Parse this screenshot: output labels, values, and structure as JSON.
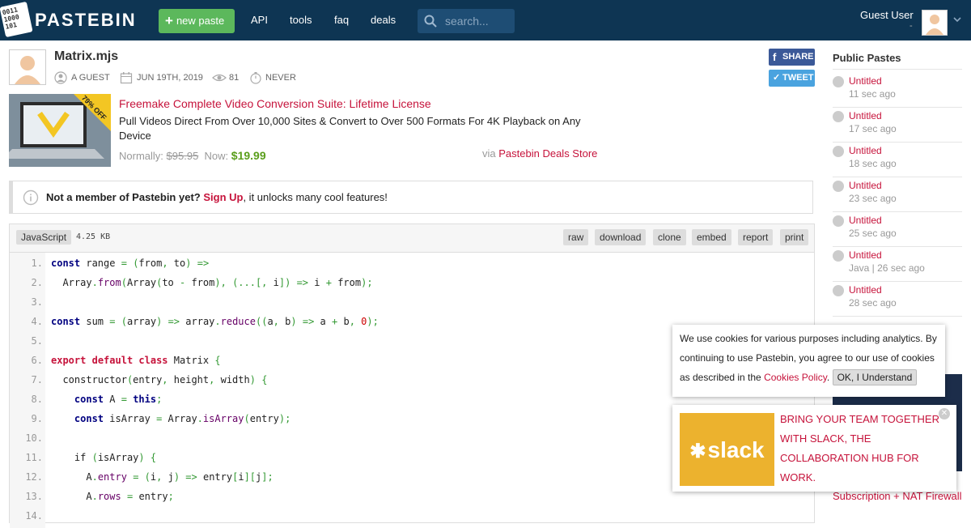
{
  "header": {
    "logo_text": "PASTEBIN",
    "logo_bits": "0011 1000 101",
    "new_paste": "new paste",
    "nav": [
      "API",
      "tools",
      "faq",
      "deals"
    ],
    "search_placeholder": "search...",
    "user_name": "Guest User",
    "user_sub": "-"
  },
  "paste": {
    "title": "Matrix.mjs",
    "author": "A GUEST",
    "date": "JUN 19TH, 2019",
    "views": "81",
    "expires": "NEVER",
    "share": "SHARE",
    "tweet": "TWEET"
  },
  "ad": {
    "badge": "79% OFF",
    "title": "Freemake Complete Video Conversion Suite: Lifetime License",
    "desc": "Pull Videos Direct From Over 10,000 Sites & Convert to Over 500 Formats For 4K Playback on Any Device",
    "normally_label": "Normally:",
    "normally_price": "$95.95",
    "now_label": "Now:",
    "now_price": "$19.99",
    "via_label": "via",
    "via_link": "Pastebin Deals Store"
  },
  "notice": {
    "bold": "Not a member of Pastebin yet?",
    "link": "Sign Up",
    "rest": ", it unlocks many cool features!"
  },
  "code": {
    "language": "JavaScript",
    "size": "4.25 KB",
    "buttons": [
      "raw",
      "download",
      "clone",
      "embed",
      "report",
      "print"
    ],
    "line_numbers": [
      "1.",
      "2.",
      "3.",
      "4.",
      "5.",
      "6.",
      "7.",
      "8.",
      "9.",
      "10.",
      "11.",
      "12.",
      "13.",
      "14."
    ],
    "lines": [
      "const range = (from, to) =>",
      "  Array.from(Array(to - from), (...[, i]) => i + from);",
      "",
      "const sum = (array) => array.reduce((a, b) => a + b, 0);",
      "",
      "export default class Matrix {",
      "  constructor(entry, height, width) {",
      "    const A = this;",
      "    const isArray = Array.isArray(entry);",
      "",
      "    if (isArray) {",
      "      A.entry = (i, j) => entry[i][j];",
      "      A.rows = entry;",
      ""
    ]
  },
  "sidebar": {
    "title": "Public Pastes",
    "items": [
      {
        "name": "Untitled",
        "time": "11 sec ago"
      },
      {
        "name": "Untitled",
        "time": "17 sec ago"
      },
      {
        "name": "Untitled",
        "time": "18 sec ago"
      },
      {
        "name": "Untitled",
        "time": "23 sec ago"
      },
      {
        "name": "Untitled",
        "time": "25 sec ago"
      },
      {
        "name": "Untitled",
        "time": "Java | 26 sec ago"
      },
      {
        "name": "Untitled",
        "time": "28 sec ago"
      }
    ],
    "bottom_link": "Subscription + NAT Firewall"
  },
  "cookie": {
    "text": "We use cookies for various purposes including analytics. By continuing to use Pastebin, you agree to our use of cookies as described in the",
    "link": "Cookies Policy",
    "ok": "OK, I Understand"
  },
  "slack_ad": {
    "logo": "slack",
    "text": "BRING YOUR TEAM TOGETHER WITH SLACK, THE COLLABORATION HUB FOR WORK."
  },
  "colors": {
    "header_bg": "#0e3553",
    "accent_red": "#c6133b",
    "new_paste_green": "#5cb85c",
    "price_green": "#5a9e1b"
  }
}
